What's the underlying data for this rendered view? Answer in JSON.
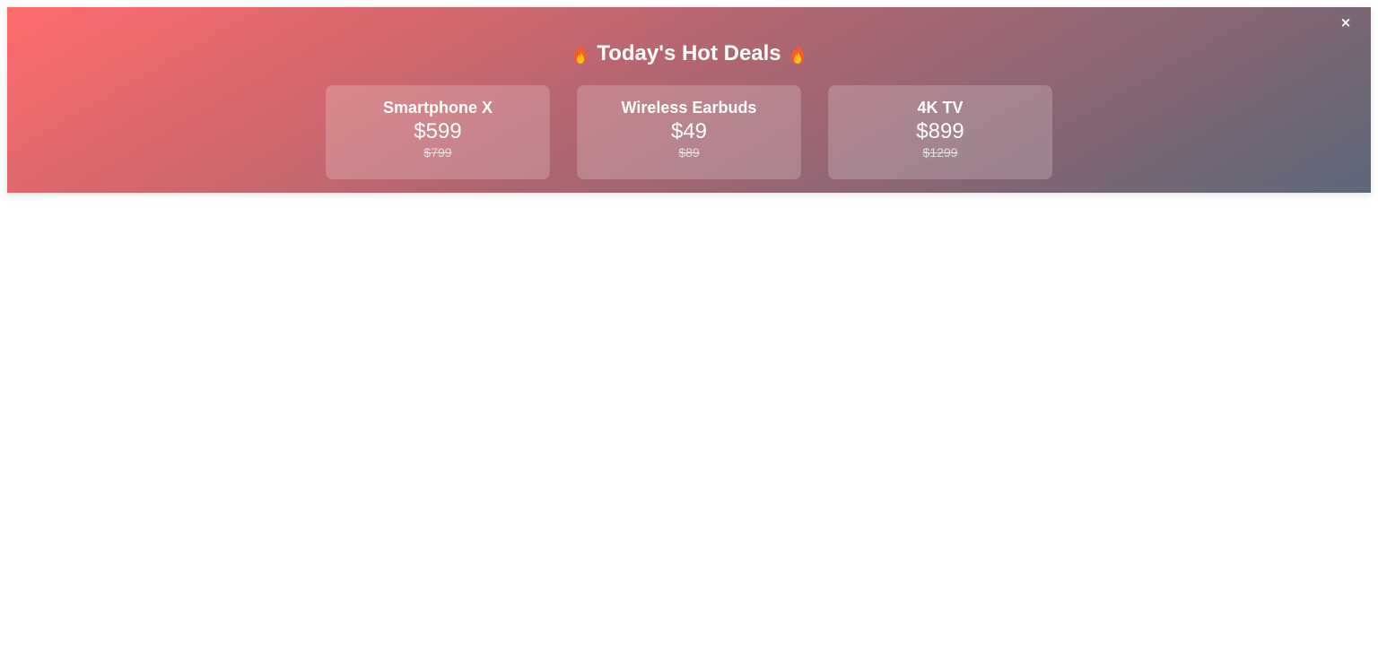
{
  "banner": {
    "close_label": "×",
    "title": "Today's Hot Deals",
    "leading_icon": "flame-icon",
    "trailing_icon": "flame-icon",
    "gradient": [
      "#ff6b6b",
      "#5d6778"
    ]
  },
  "deals": [
    {
      "name": "Smartphone X",
      "price": "$599",
      "original_price": "$799"
    },
    {
      "name": "Wireless Earbuds",
      "price": "$49",
      "original_price": "$89"
    },
    {
      "name": "4K TV",
      "price": "$899",
      "original_price": "$1299"
    }
  ]
}
